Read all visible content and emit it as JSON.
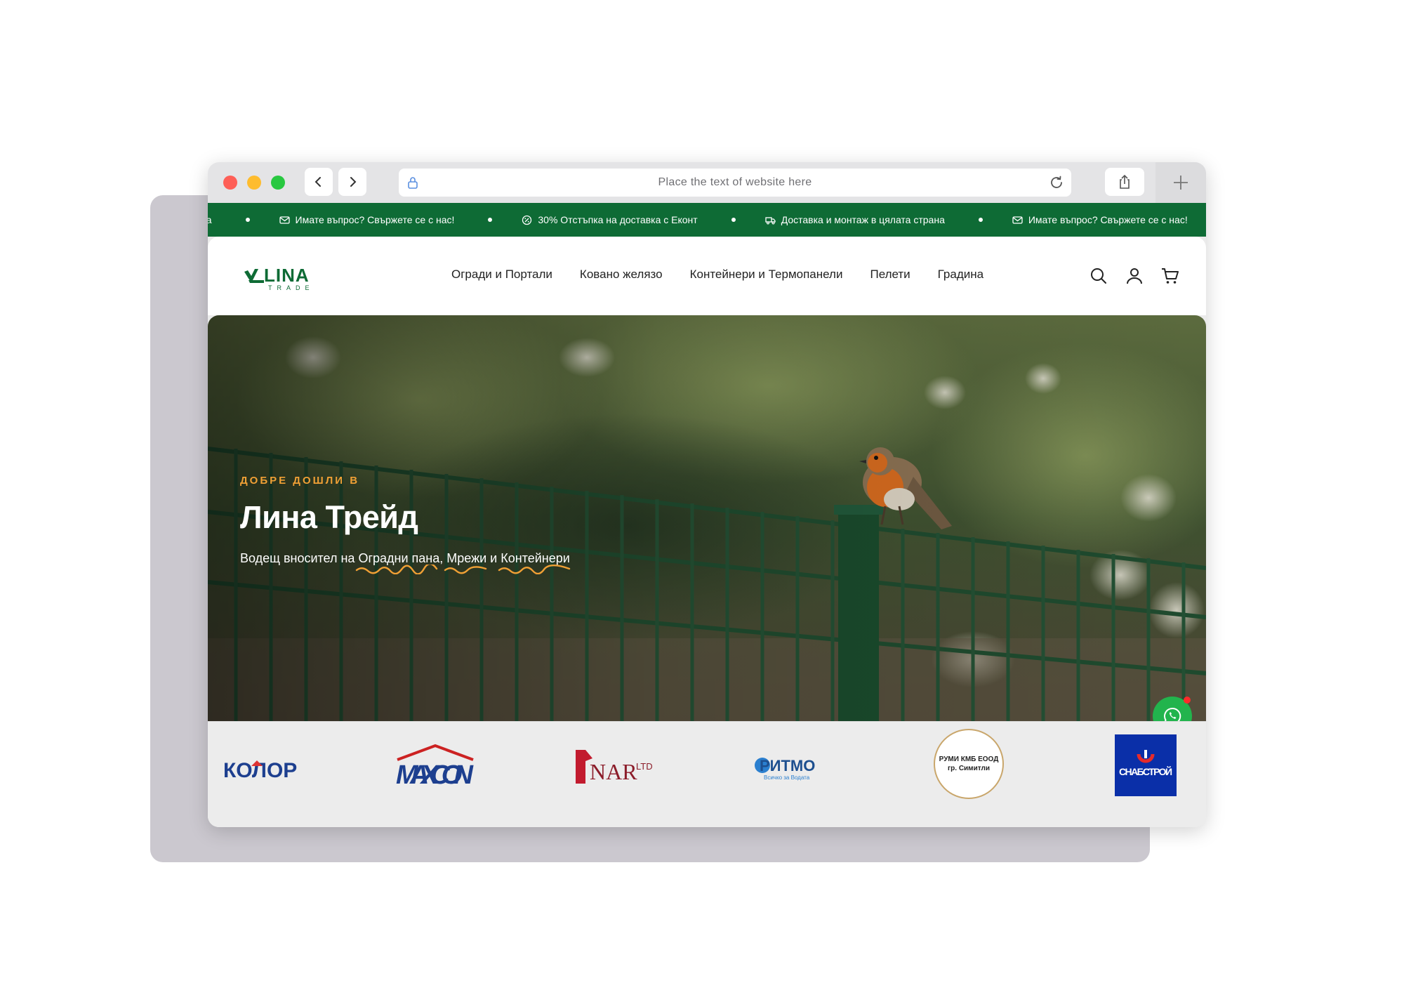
{
  "browser": {
    "address_placeholder": "Place the text of website here"
  },
  "ticker": {
    "items": [
      {
        "icon": "mail-icon",
        "text": "Имате въпрос? Свържете се с нас!"
      },
      {
        "icon": "discount-icon",
        "text": "30% Отстъпка на доставка с Еконт"
      },
      {
        "icon": "truck-icon",
        "text": "Доставка и монтаж в цялата страна"
      },
      {
        "icon": "mail-icon",
        "text": "Имате въпрос? Свържете се с нас!"
      }
    ],
    "clipped_prefix": "на"
  },
  "header": {
    "logo_text": "LINA",
    "logo_subtext": "TRADE",
    "menu": [
      {
        "label": "Огради и Портали"
      },
      {
        "label": "Ковано желязо"
      },
      {
        "label": "Контейнери и Термопанели"
      },
      {
        "label": "Пелети"
      },
      {
        "label": "Градина"
      }
    ],
    "icons": [
      "search-icon",
      "user-icon",
      "cart-icon"
    ]
  },
  "hero": {
    "eyebrow": "ДОБРЕ ДОШЛИ В",
    "title": "Лина Трейд",
    "subtitle_prefix": "Водещ вносител на ",
    "subtitle_highlight_1": "Оградни пана",
    "subtitle_sep_1": ", ",
    "subtitle_highlight_2": "Мрежи",
    "subtitle_sep_2": " и ",
    "subtitle_highlight_3": "Контейнери",
    "accent_color": "#f0a035"
  },
  "brands": [
    {
      "name": "КОЛОР"
    },
    {
      "name": "MAXCON"
    },
    {
      "name": "NAR",
      "suffix": "LTD"
    },
    {
      "name": "РИТМО",
      "tagline": "Всичко за Водата"
    },
    {
      "name_line1": "РУМИ КМБ ЕООД",
      "name_line2": "гр. Симитли"
    },
    {
      "name": "СНАБСТРОЙ"
    }
  ],
  "colors": {
    "brand_green": "#0e6b35",
    "whatsapp_green": "#22b44d"
  }
}
